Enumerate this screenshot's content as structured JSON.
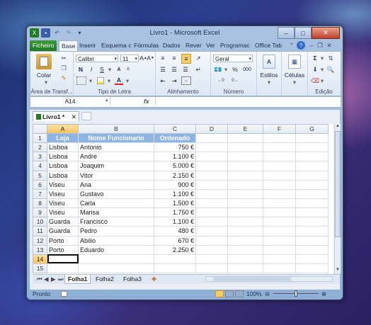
{
  "window": {
    "title": "Livro1 - Microsoft Excel"
  },
  "window_controls": {
    "minimize": "–",
    "maximize": "□",
    "close": "✕"
  },
  "ribbon_tabs": [
    "Ficheiro",
    "Base",
    "Inserir",
    "Esquema c",
    "Fórmulas",
    "Dados",
    "Rever",
    "Ver",
    "Programac",
    "Office Tab"
  ],
  "ribbon": {
    "clipboard": {
      "paste": "Colar",
      "label": "Área de Transf..."
    },
    "font": {
      "name": "Calibri",
      "size": "11",
      "bold": "N",
      "italic": "I",
      "underline": "S",
      "label": "Tipo de Letra"
    },
    "alignment": {
      "label": "Alinhamento"
    },
    "number": {
      "format": "Geral",
      "percent": "%",
      "thousands": "000",
      "label": "Número"
    },
    "styles": {
      "label": "Estilos"
    },
    "cells": {
      "label": "Células"
    },
    "editing": {
      "label": "Edição"
    }
  },
  "formula_bar": {
    "name_box": "A14",
    "fx": "fx",
    "value": ""
  },
  "document_tab": {
    "label": "Livro1 *"
  },
  "columns": [
    "A",
    "B",
    "C",
    "D",
    "E",
    "F",
    "G"
  ],
  "header_row": {
    "loja": "Loja",
    "nome": "Nome Funcionario",
    "ordenado": "Ordenado"
  },
  "rows": [
    {
      "n": "2",
      "loja": "Lisboa",
      "nome": "Antonio",
      "ordenado": "750 €"
    },
    {
      "n": "3",
      "loja": "Lisboa",
      "nome": "Andre",
      "ordenado": "1.100 €"
    },
    {
      "n": "4",
      "loja": "Lisboa",
      "nome": "Joaquim",
      "ordenado": "5.000 €"
    },
    {
      "n": "5",
      "loja": "Lisboa",
      "nome": "Vitor",
      "ordenado": "2.150 €"
    },
    {
      "n": "6",
      "loja": "Viseu",
      "nome": "Ana",
      "ordenado": "900 €"
    },
    {
      "n": "7",
      "loja": "Viseu",
      "nome": "Gustavo",
      "ordenado": "1.100 €"
    },
    {
      "n": "8",
      "loja": "Viseu",
      "nome": "Carla",
      "ordenado": "1.500 €"
    },
    {
      "n": "9",
      "loja": "Viseu",
      "nome": "Marisa",
      "ordenado": "1.750 €"
    },
    {
      "n": "10",
      "loja": "Guarda",
      "nome": "Francisco",
      "ordenado": "1.100 €"
    },
    {
      "n": "11",
      "loja": "Guarda",
      "nome": "Pedro",
      "ordenado": "480 €"
    },
    {
      "n": "12",
      "loja": "Porto",
      "nome": "Abilio",
      "ordenado": "670 €"
    },
    {
      "n": "13",
      "loja": "Porto",
      "nome": "Eduardo",
      "ordenado": "2.250 €"
    }
  ],
  "row_numbers_extra": [
    "1",
    "14",
    "15"
  ],
  "sheets": [
    "Folha1",
    "Folha2",
    "Folha3"
  ],
  "status": {
    "ready": "Pronto",
    "zoom": "100%"
  },
  "colors": {
    "header_fill": "#8db4e2",
    "selection": "#f4c25c",
    "file_tab": "#1f7a22"
  }
}
